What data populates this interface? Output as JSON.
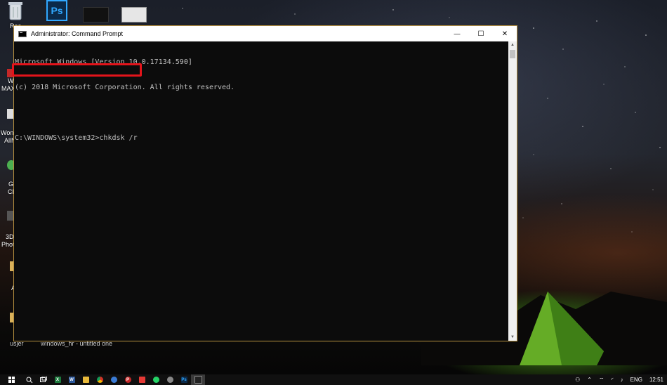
{
  "desktop": {
    "icons_top": [
      {
        "label": "Rec",
        "icon": "recycle-bin-icon"
      },
      {
        "label": "",
        "icon": "photoshop-icon"
      },
      {
        "label": "",
        "icon": "shortcut-thumbnail-icon"
      },
      {
        "label": "",
        "icon": "shortcut-thumbnail-icon"
      }
    ],
    "left_labels": [
      "W",
      "MAX",
      "Won",
      "AllN",
      "G",
      "Ch",
      "3D",
      "Phot",
      "A"
    ],
    "bottom_labels": [
      "usjer",
      "windows_hr - untitled one"
    ]
  },
  "window": {
    "title": "Administrator: Command Prompt",
    "buttons": {
      "minimize": "—",
      "maximize": "☐",
      "close": "✕"
    },
    "console_lines": [
      "Microsoft Windows [Version 10.0.17134.590]",
      "(c) 2018 Microsoft Corporation. All rights reserved.",
      "",
      "C:\\WINDOWS\\system32>chkdsk /r"
    ]
  },
  "taskbar": {
    "apps": [
      {
        "name": "start",
        "icon": "windows-start-icon"
      },
      {
        "name": "search",
        "icon": "search-icon"
      },
      {
        "name": "task-view",
        "icon": "task-view-icon"
      },
      {
        "name": "excel",
        "icon": "excel-icon",
        "letter": "X",
        "color": "#1d7a3e"
      },
      {
        "name": "word",
        "icon": "word-icon",
        "letter": "W",
        "color": "#2b579a"
      },
      {
        "name": "explorer",
        "icon": "folder-icon",
        "letter": "",
        "color": "#e8b93a"
      },
      {
        "name": "chrome",
        "icon": "chrome-icon",
        "letter": "",
        "color": "#d93025"
      },
      {
        "name": "app-blue",
        "icon": "globe-icon",
        "letter": "",
        "color": "#3a7bd5"
      },
      {
        "name": "app-red",
        "icon": "p-app-icon",
        "letter": "P",
        "color": "#c62828"
      },
      {
        "name": "app-red2",
        "icon": "app-icon",
        "letter": "",
        "color": "#e53935"
      },
      {
        "name": "whatsapp",
        "icon": "whatsapp-icon",
        "letter": "",
        "color": "#25d366"
      },
      {
        "name": "app-gray",
        "icon": "camera-icon",
        "letter": "",
        "color": "#888888"
      },
      {
        "name": "photoshop",
        "icon": "photoshop-icon",
        "letter": "Ps",
        "color": "#0b2a4a"
      },
      {
        "name": "cmd",
        "icon": "command-prompt-icon",
        "letter": "",
        "color": "#444444"
      }
    ],
    "tray": {
      "language": "ENG",
      "time": "12:51"
    }
  },
  "colors": {
    "highlight": "#e3141b",
    "window_border": "#b58f3f",
    "console_bg": "#0c0c0c",
    "console_text": "#c0c0c0"
  }
}
